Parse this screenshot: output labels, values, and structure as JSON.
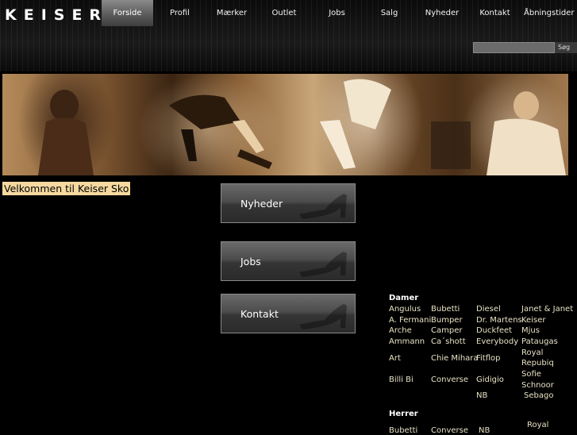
{
  "logo": {
    "text": "KEISER"
  },
  "nav": {
    "items": [
      {
        "label": "Forside"
      },
      {
        "label": "Profil"
      },
      {
        "label": "Mærker"
      },
      {
        "label": "Outlet"
      },
      {
        "label": "Jobs"
      },
      {
        "label": "Salg"
      },
      {
        "label": "Nyheder"
      },
      {
        "label": "Kontakt"
      },
      {
        "label": "Åbningstider"
      }
    ]
  },
  "search": {
    "button_label": "Søg",
    "value": ""
  },
  "welcome": {
    "text": "Velkommen til Keiser Sko"
  },
  "promos": [
    {
      "label": "Nyheder"
    },
    {
      "label": "Jobs"
    },
    {
      "label": "Kontakt"
    }
  ],
  "brands": {
    "damer": {
      "heading": "Damer",
      "col1": [
        "Angulus",
        "A. Fermani",
        "Arche",
        "Ammann",
        "Art",
        "Billi Bi"
      ],
      "col2": [
        "Bubetti",
        "Bumper",
        "Camper",
        "Ca´shott",
        "Chie Mihara",
        "Converse"
      ],
      "col3": [
        "Diesel",
        "Dr. Martens",
        "Duckfeet",
        "Everybody",
        "Fitflop",
        "Gidigio",
        "NB"
      ],
      "col4": [
        "Janet & Janet",
        "Keiser",
        "Mjus",
        "Pataugas",
        "Royal",
        "Repubiq",
        "Sofie",
        "Schnoor",
        "Sebago"
      ]
    },
    "herrer": {
      "heading": "Herrer",
      "col1": [
        "Bubetti"
      ],
      "col2": [
        "Converse"
      ],
      "col3": [
        "NB"
      ],
      "col4": [
        "Royal"
      ]
    }
  },
  "colors": {
    "background": "#000000",
    "welcome_bg": "#f5d9a0",
    "nav_active": "#6e6e6e",
    "brand_link": "#e9e2c6"
  }
}
